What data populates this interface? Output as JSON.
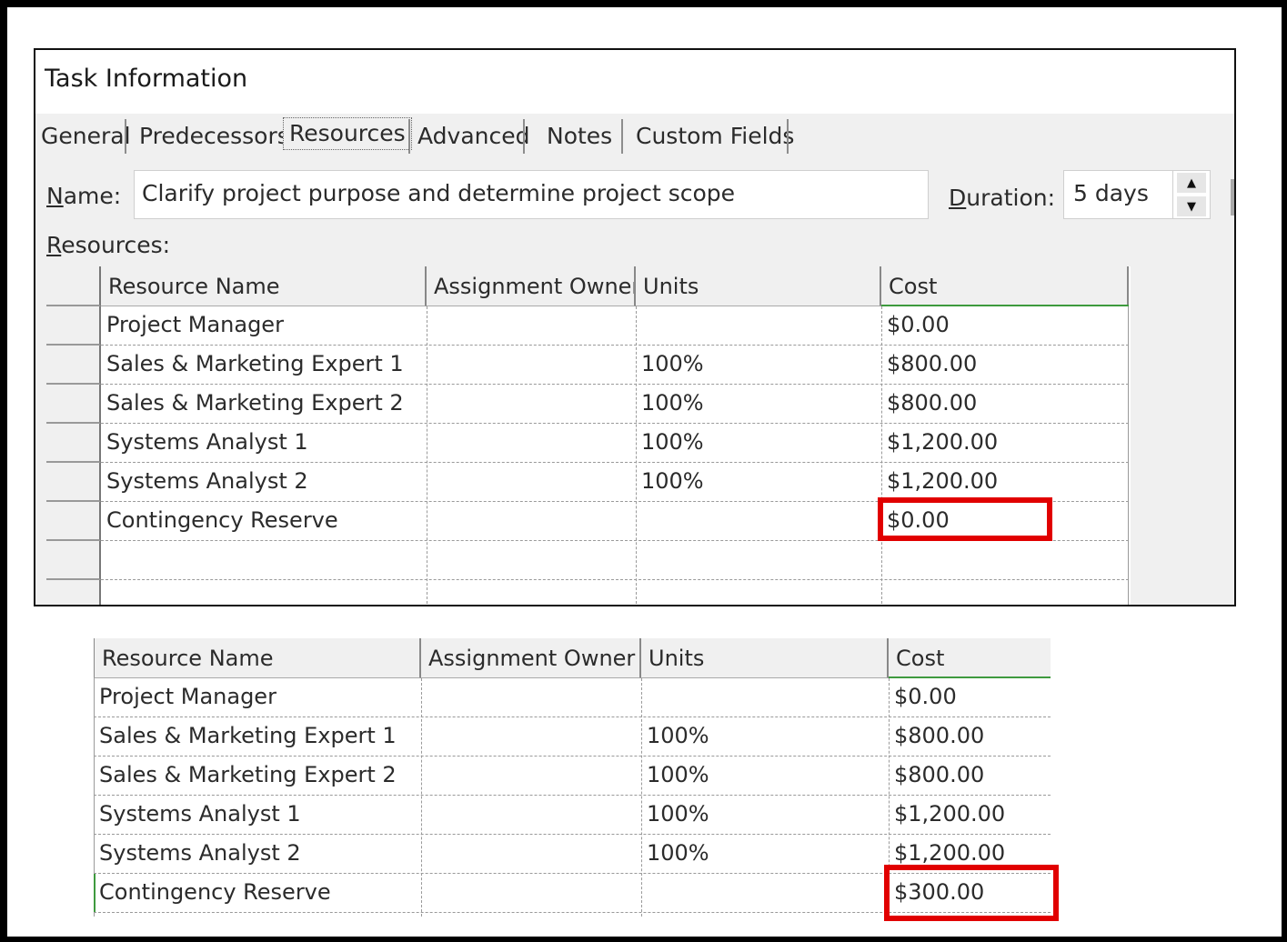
{
  "dialog": {
    "title": "Task Information",
    "tabs": [
      "General",
      "Predecessors",
      "Resources",
      "Advanced",
      "Notes",
      "Custom Fields"
    ],
    "active_tab": "Resources",
    "name_label_u": "N",
    "name_label_rest": "ame:",
    "name_value": "Clarify project purpose and determine project scope",
    "duration_label_u": "D",
    "duration_label_rest": "uration:",
    "duration_value": "5 days",
    "resources_label_u": "R",
    "resources_label_rest": "esources:"
  },
  "grid_before": {
    "headers": [
      "Resource Name",
      "Assignment Owner",
      "Units",
      "Cost"
    ],
    "rows": [
      [
        "Project Manager",
        "",
        "",
        "$0.00"
      ],
      [
        "Sales & Marketing Expert 1",
        "",
        "100%",
        "$800.00"
      ],
      [
        "Sales & Marketing Expert 2",
        "",
        "100%",
        "$800.00"
      ],
      [
        "Systems Analyst 1",
        "",
        "100%",
        "$1,200.00"
      ],
      [
        "Systems Analyst 2",
        "",
        "100%",
        "$1,200.00"
      ],
      [
        "Contingency Reserve",
        "",
        "",
        "$0.00"
      ],
      [
        "",
        "",
        "",
        ""
      ],
      [
        "",
        "",
        "",
        ""
      ]
    ]
  },
  "grid_after": {
    "headers": [
      "Resource Name",
      "Assignment Owner",
      "Units",
      "Cost"
    ],
    "rows": [
      [
        "Project Manager",
        "",
        "",
        "$0.00"
      ],
      [
        "Sales & Marketing Expert 1",
        "",
        "100%",
        "$800.00"
      ],
      [
        "Sales & Marketing Expert 2",
        "",
        "100%",
        "$800.00"
      ],
      [
        "Systems Analyst 1",
        "",
        "100%",
        "$1,200.00"
      ],
      [
        "Systems Analyst 2",
        "",
        "100%",
        "$1,200.00"
      ],
      [
        "Contingency Reserve",
        "",
        "",
        "$300.00"
      ]
    ]
  },
  "colors": {
    "highlight": "#e10000",
    "header_underline": "#3e9a3e"
  },
  "icons": {
    "spinner_up": "spin-up-icon",
    "spinner_down": "spin-down-icon"
  }
}
